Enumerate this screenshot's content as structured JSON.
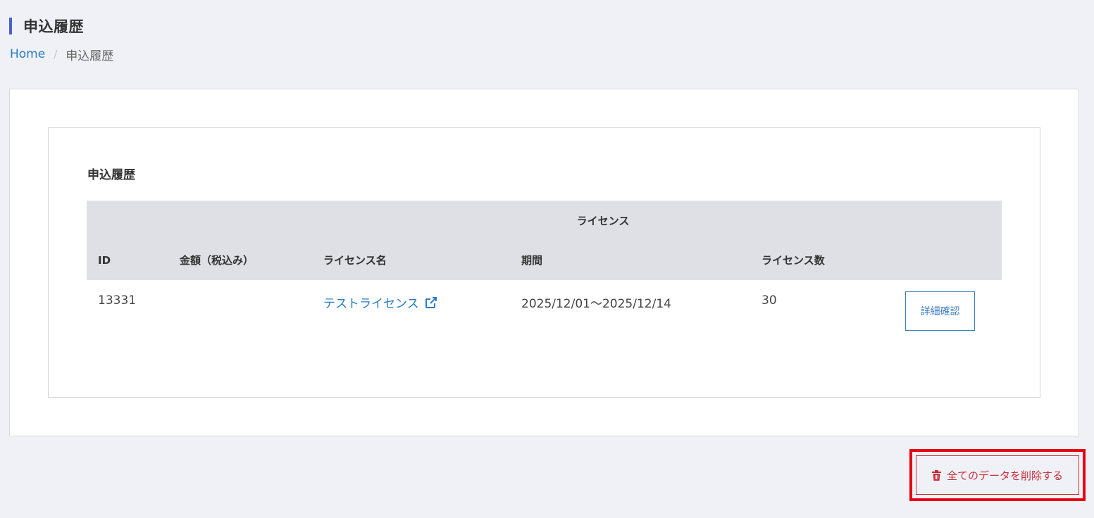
{
  "page": {
    "title": "申込履歴"
  },
  "breadcrumb": {
    "home": "Home",
    "separator": "/",
    "current": "申込履歴"
  },
  "section": {
    "title": "申込履歴"
  },
  "table": {
    "group_header": "ライセンス",
    "headers": {
      "id": "ID",
      "amount": "金額（税込み）",
      "license_name": "ライセンス名",
      "period": "期間",
      "license_count": "ライセンス数"
    },
    "rows": [
      {
        "id": "13331",
        "amount": "",
        "license_name": "テストライセンス",
        "period": "2025/12/01〜2025/12/14",
        "license_count": "30",
        "action": "詳細確認"
      }
    ]
  },
  "actions": {
    "delete_all": "全てのデータを削除する"
  },
  "colors": {
    "accent": "#4a5fd4",
    "link": "#2a7cc7",
    "danger": "#c5303b",
    "highlight": "#e60012"
  },
  "icons": {
    "license_link": "external-link-icon",
    "delete": "trash-icon"
  }
}
